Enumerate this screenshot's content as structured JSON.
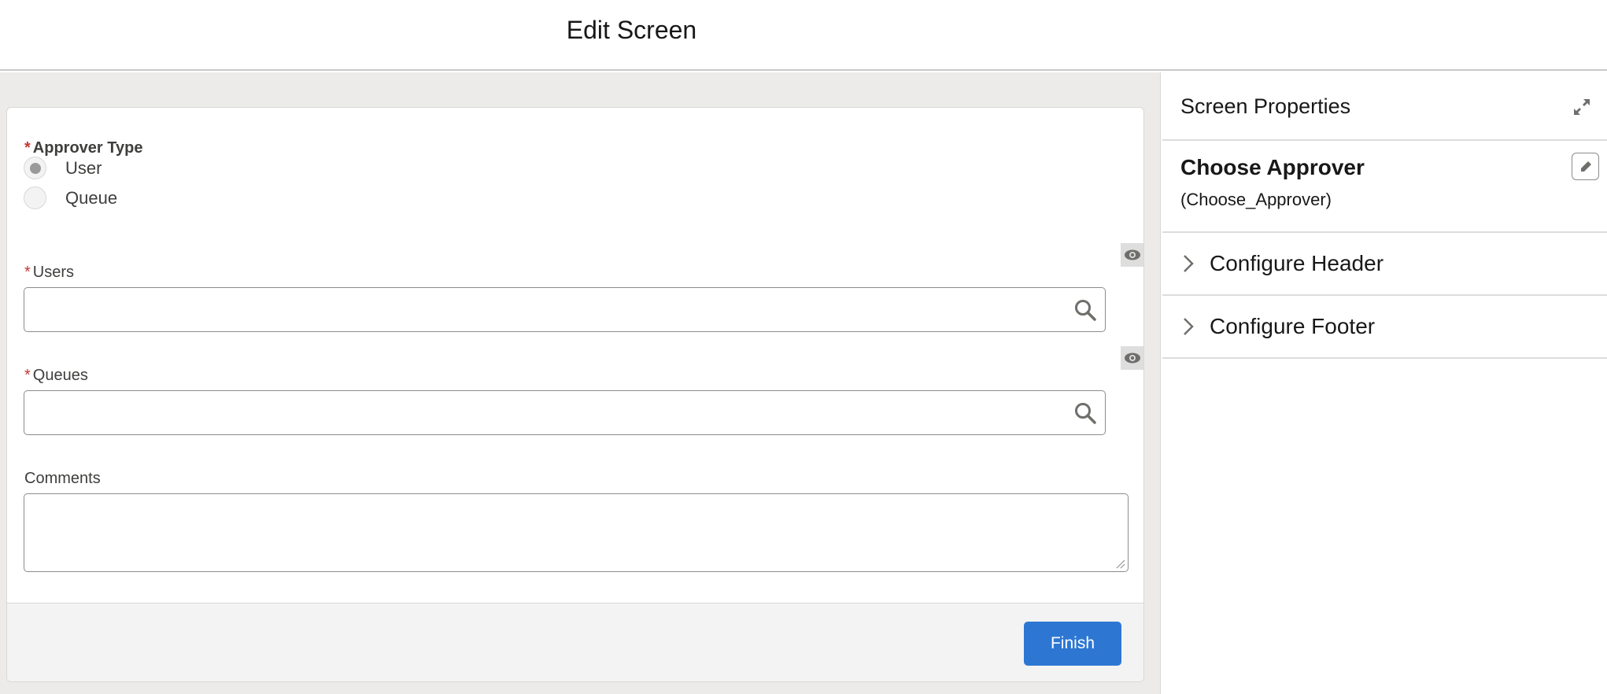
{
  "header": {
    "title": "Edit Screen"
  },
  "form": {
    "approver_type": {
      "label": "Approver Type",
      "required": "*",
      "options": [
        {
          "label": "User",
          "selected": true
        },
        {
          "label": "Queue",
          "selected": false
        }
      ]
    },
    "users": {
      "label": "Users",
      "required": "*",
      "value": ""
    },
    "queues": {
      "label": "Queues",
      "required": "*",
      "value": ""
    },
    "comments": {
      "label": "Comments",
      "value": ""
    },
    "finish_label": "Finish"
  },
  "panel": {
    "title": "Screen Properties",
    "screen_name": "Choose Approver",
    "api_name": "(Choose_Approver)",
    "sections": [
      "Configure Header",
      "Configure Footer"
    ]
  },
  "colors": {
    "accent": "#2d77d3",
    "required": "#c23934"
  }
}
